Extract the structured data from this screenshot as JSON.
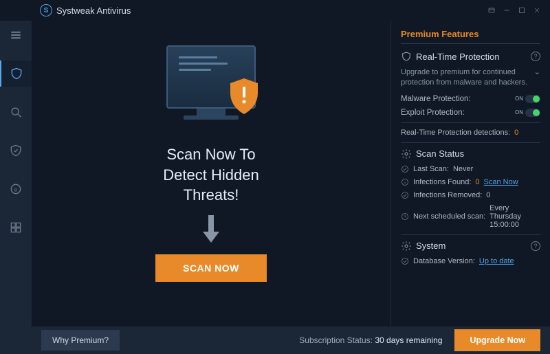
{
  "titlebar": {
    "app_name": "Systweak Antivirus"
  },
  "center": {
    "headline_l1": "Scan Now To",
    "headline_l2": "Detect Hidden",
    "headline_l3": "Threats!",
    "scan_button": "SCAN NOW"
  },
  "right": {
    "title": "Premium Features",
    "rtp": {
      "heading": "Real-Time Protection",
      "desc": "Upgrade to premium for continued protection from malware and hackers.",
      "malware_label": "Malware Protection:",
      "exploit_label": "Exploit Protection:",
      "on_text": "ON",
      "detections_label": "Real-Time Protection detections:",
      "detections_value": "0"
    },
    "scan": {
      "heading": "Scan Status",
      "last_scan_label": "Last Scan:",
      "last_scan_value": "Never",
      "infections_found_label": "Infections Found:",
      "infections_found_value": "0",
      "scan_now_link": "Scan Now",
      "infections_removed_label": "Infections Removed:",
      "infections_removed_value": "0",
      "next_label": "Next scheduled scan:",
      "next_value": "Every Thursday 15:00:00"
    },
    "system": {
      "heading": "System",
      "db_label": "Database Version:",
      "db_value": "Up to date"
    }
  },
  "footer": {
    "why_premium": "Why Premium?",
    "sub_label": "Subscription Status:",
    "sub_value": "30 days remaining",
    "upgrade": "Upgrade Now"
  }
}
